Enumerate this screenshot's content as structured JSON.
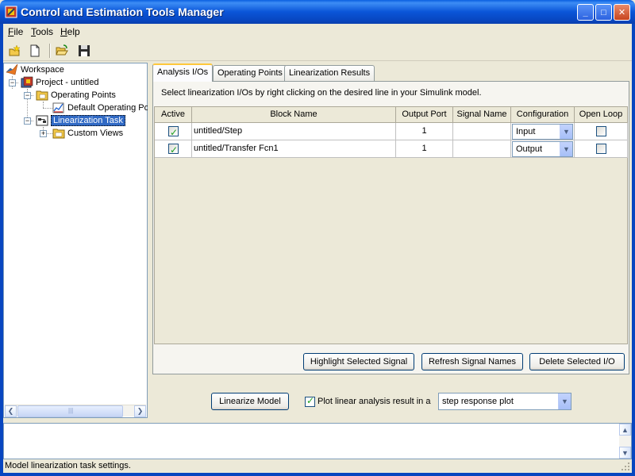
{
  "window": {
    "title": "Control and Estimation Tools Manager",
    "controls": {
      "minimize": "_",
      "maximize": "□",
      "close": "✕"
    }
  },
  "menu": [
    {
      "mnemonic": "F",
      "rest": "ile"
    },
    {
      "mnemonic": "T",
      "rest": "ools"
    },
    {
      "mnemonic": "H",
      "rest": "elp"
    }
  ],
  "toolbar": {
    "icons": [
      "new-project-icon",
      "new-document-icon",
      "open-folder-icon",
      "save-disk-icon"
    ]
  },
  "tree": {
    "workspace": "Workspace",
    "project": "Project - untitled",
    "operating_points": "Operating Points",
    "default_operating_point": "Default Operating Po",
    "linearization_task": "Linearization Task",
    "custom_views": "Custom Views",
    "collapse_symbol": "−",
    "expand_symbol": "+"
  },
  "tabs": [
    {
      "label": "Analysis I/Os",
      "active": true
    },
    {
      "label": "Operating Points",
      "active": false
    },
    {
      "label": "Linearization Results",
      "active": false
    }
  ],
  "instruction": "Select linearization I/Os by right clicking on the desired line in your Simulink model.",
  "table": {
    "headers": [
      "Active",
      "Block Name",
      "Output Port",
      "Signal Name",
      "Configuration",
      "Open Loop"
    ],
    "rows": [
      {
        "active": true,
        "block": "untitled/Step",
        "port": "1",
        "signal": "",
        "config": "Input",
        "open_loop": false
      },
      {
        "active": true,
        "block": "untitled/Transfer Fcn1",
        "port": "1",
        "signal": "",
        "config": "Output",
        "open_loop": false
      }
    ]
  },
  "buttons": {
    "highlight": "Highlight Selected Signal",
    "refresh": "Refresh Signal Names",
    "delete": "Delete Selected I/O",
    "linearize": "Linearize Model"
  },
  "plot_option": {
    "checked": true,
    "label": "Plot linear analysis result in a",
    "selected": "step response plot"
  },
  "status": "Model linearization task settings.",
  "glyphs": {
    "check": "✓",
    "down": "▼",
    "up": "▲",
    "left": "❮",
    "right": "❯",
    "grip": "|||"
  }
}
